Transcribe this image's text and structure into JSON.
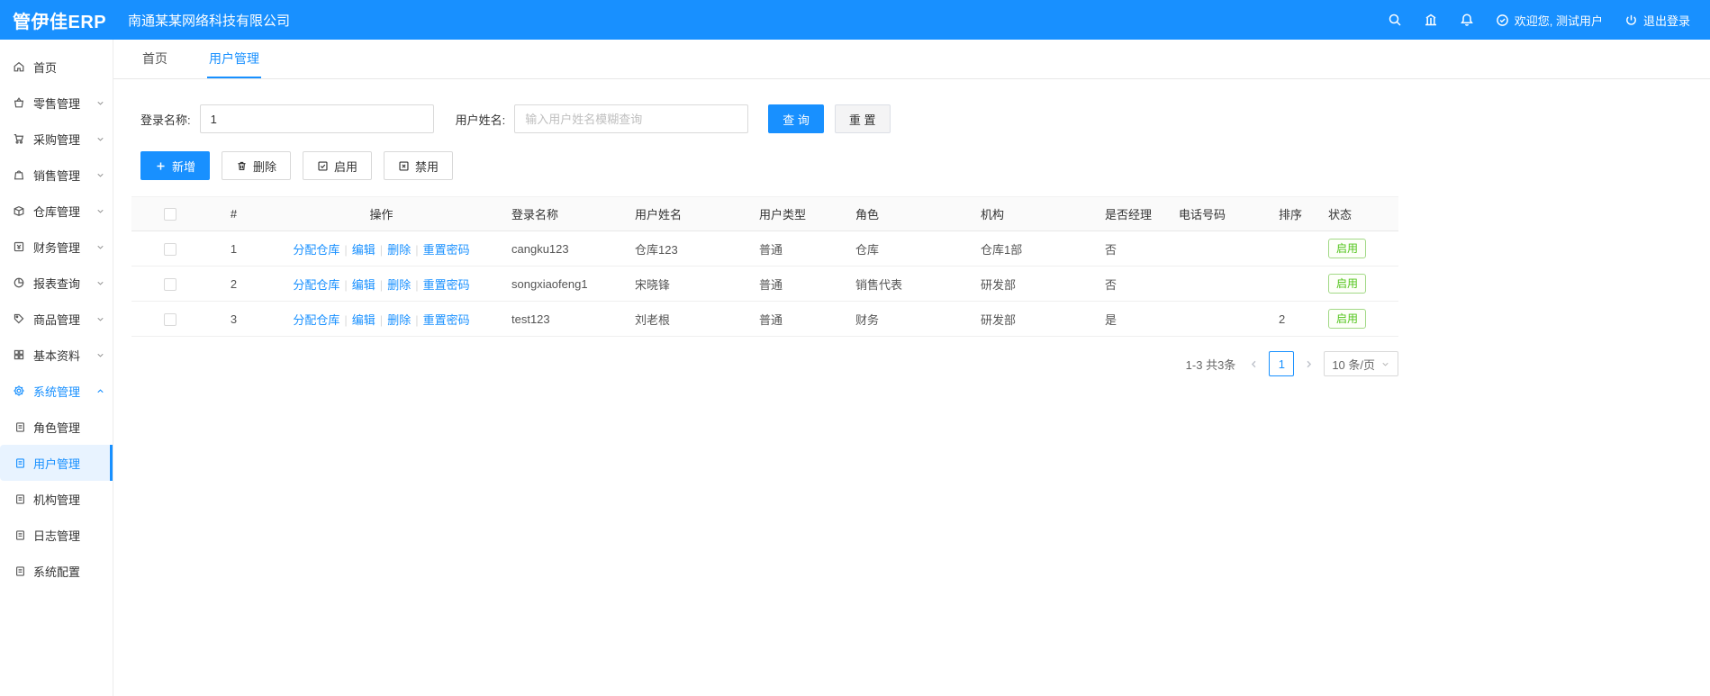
{
  "colors": {
    "primary": "#1890ff",
    "success": "#52c41a"
  },
  "header": {
    "logo": "管伊佳ERP",
    "company": "南通某某网络科技有限公司",
    "welcome": "欢迎您, 测试用户",
    "logout": "退出登录"
  },
  "sidebar": {
    "items": [
      {
        "label": "首页"
      },
      {
        "label": "零售管理"
      },
      {
        "label": "采购管理"
      },
      {
        "label": "销售管理"
      },
      {
        "label": "仓库管理"
      },
      {
        "label": "财务管理"
      },
      {
        "label": "报表查询"
      },
      {
        "label": "商品管理"
      },
      {
        "label": "基本资料"
      },
      {
        "label": "系统管理"
      }
    ],
    "subitems": [
      {
        "label": "角色管理"
      },
      {
        "label": "用户管理"
      },
      {
        "label": "机构管理"
      },
      {
        "label": "日志管理"
      },
      {
        "label": "系统配置"
      }
    ]
  },
  "tabs": [
    {
      "label": "首页"
    },
    {
      "label": "用户管理"
    }
  ],
  "search": {
    "login_label": "登录名称:",
    "login_value": "1",
    "name_label": "用户姓名:",
    "name_placeholder": "输入用户姓名模糊查询",
    "query": "查 询",
    "reset": "重 置"
  },
  "toolbar": {
    "add": "新增",
    "delete": "删除",
    "enable": "启用",
    "disable": "禁用"
  },
  "table": {
    "headers": {
      "num": "#",
      "op": "操作",
      "login": "登录名称",
      "name": "用户姓名",
      "type": "用户类型",
      "role": "角色",
      "org": "机构",
      "manager": "是否经理",
      "phone": "电话号码",
      "sort": "排序",
      "status": "状态"
    },
    "op_links": [
      "分配仓库",
      "编辑",
      "删除",
      "重置密码"
    ],
    "op_separator": "|",
    "rows": [
      {
        "num": "1",
        "login": "cangku123",
        "name": "仓库123",
        "type": "普通",
        "role": "仓库",
        "org": "仓库1部",
        "manager": "否",
        "phone": "",
        "sort": "",
        "status": "启用"
      },
      {
        "num": "2",
        "login": "songxiaofeng1",
        "name": "宋晓锋",
        "type": "普通",
        "role": "销售代表",
        "org": "研发部",
        "manager": "否",
        "phone": "",
        "sort": "",
        "status": "启用"
      },
      {
        "num": "3",
        "login": "test123",
        "name": "刘老根",
        "type": "普通",
        "role": "财务",
        "org": "研发部",
        "manager": "是",
        "phone": "",
        "sort": "2",
        "status": "启用"
      }
    ]
  },
  "pagination": {
    "total": "1-3 共3条",
    "page": "1",
    "page_size": "10 条/页"
  }
}
